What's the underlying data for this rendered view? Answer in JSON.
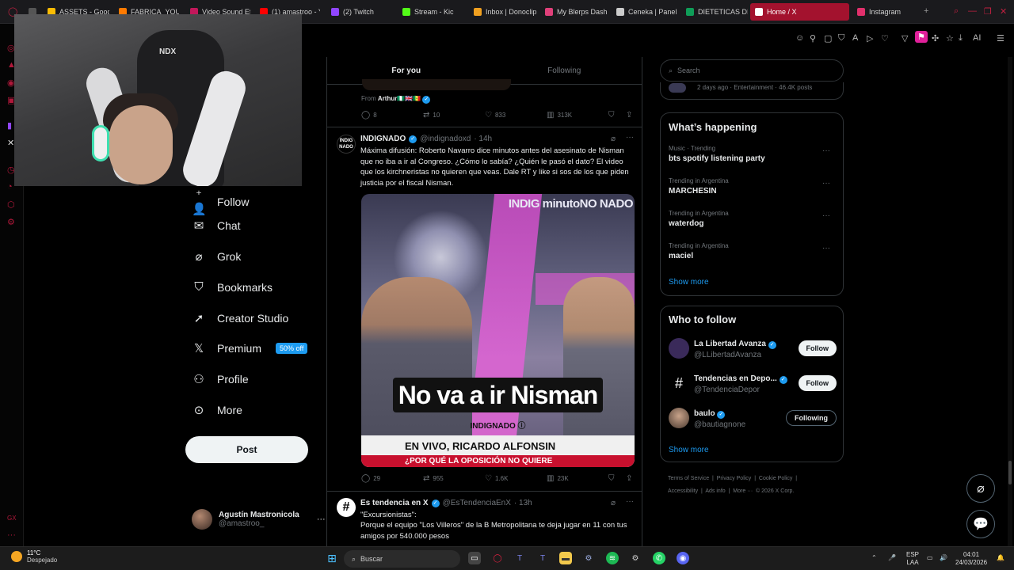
{
  "browser": {
    "tabs": [
      {
        "label": "",
        "color": "#555555"
      },
      {
        "label": "ASSETS - Goog",
        "color": "#fbbc04"
      },
      {
        "label": "FABRICA_YOUT",
        "color": "#ff7a00"
      },
      {
        "label": "Video Sound Ef",
        "color": "#c2185b"
      },
      {
        "label": "(1) amastroo - Y",
        "color": "#ff0000"
      },
      {
        "label": "(2) Twitch",
        "color": "#9146ff"
      },
      {
        "label": "Stream - Kic",
        "color": "#53fc18"
      },
      {
        "label": "Inbox | Donoclip",
        "color": "#f0a020"
      },
      {
        "label": "My Blerps Dash",
        "color": "#e0407a"
      },
      {
        "label": "Ceneka | Panel",
        "color": "#cccccc"
      },
      {
        "label": "DIETETICAS DI",
        "color": "#0f9d58"
      },
      {
        "label": "Home / X",
        "color": "#ffffff"
      },
      {
        "label": "Instagram",
        "color": "#e1306c"
      }
    ],
    "new_tab": "+",
    "toolbar_ai": "AI"
  },
  "sidebar": {
    "items": [
      {
        "label": "Follow",
        "icon": "+"
      },
      {
        "label": "Chat",
        "icon": "✉"
      },
      {
        "label": "Grok",
        "icon": "⌀"
      },
      {
        "label": "Bookmarks",
        "icon": "▯"
      },
      {
        "label": "Creator Studio",
        "icon": "🚀"
      },
      {
        "label": "Premium",
        "icon": "𝕏"
      },
      {
        "label": "Profile",
        "icon": "👤"
      },
      {
        "label": "More",
        "icon": "⋯"
      }
    ],
    "premium_badge": "50% off",
    "post_label": "Post",
    "account_name": "Agustín Mastronicola",
    "account_handle": "@amastroo_",
    "account_more": "···"
  },
  "timeline": {
    "tabs": [
      "For you",
      "Following"
    ],
    "prev_from_prefix": "From ",
    "prev_from_name": "Arthur🇳🇬🇬🇧🇸🇳",
    "prev_actions": {
      "replies": "8",
      "reposts": "10",
      "likes": "833",
      "views": "313K"
    },
    "tweet1": {
      "author": "INDIGNADO",
      "handle": "@indignadoxd",
      "time": "· 14h",
      "avatar_text": "INDIG NADO",
      "text": "Máxima difusión: Roberto Navarro dice minutos antes del asesinato de Nisman que no iba a ir al Congreso. ¿Cómo lo sabía? ¿Quién le pasó el dato? El video que los kirchneristas no quieren que veas. Dale RT y like si sos de los que piden justicia por el fiscal Nisman.",
      "video_watermark": "INDIG minutoNO NADO",
      "video_caption": "No va a ir Nisman",
      "video_subcaption": "INDIGNADO ⓘ",
      "video_lower": "EN VIVO, RICARDO ALFONSIN",
      "video_lower2": "¿POR QUÉ LA OPOSICIÓN NO QUIERE",
      "actions": {
        "replies": "29",
        "reposts": "955",
        "likes": "1.6K",
        "views": "23K"
      }
    },
    "tweet2": {
      "author": "Es tendencia en X",
      "handle": "@EsTendenciaEnX",
      "time": "· 13h",
      "avatar_text": "#",
      "line1": "\"Excursionistas\":",
      "line2": "Porque el equipo \"Los Villeros\" de la B Metropolitana te deja jugar en 11 con tus amigos por 540.000 pesos"
    }
  },
  "right": {
    "search_placeholder": "Search",
    "top_meta": "2 days ago · Entertainment · 46.4K posts",
    "whats_happening_title": "What’s happening",
    "trends": [
      {
        "meta": "Music · Trending",
        "topic": "bts spotify listening party"
      },
      {
        "meta": "Trending in Argentina",
        "topic": "MARCHESIN"
      },
      {
        "meta": "Trending in Argentina",
        "topic": "waterdog"
      },
      {
        "meta": "Trending in Argentina",
        "topic": "maciel"
      }
    ],
    "show_more": "Show more",
    "who_to_follow_title": "Who to follow",
    "who_to_follow": [
      {
        "name": "La Libertad Avanza",
        "handle": "@LLibertadAvanza",
        "button": "Follow"
      },
      {
        "name": "Tendencias en Depo...",
        "handle": "@TendenciaDepor",
        "button": "Follow"
      },
      {
        "name": "baulo",
        "handle": "@bautiagnone",
        "button": "Following"
      }
    ],
    "footer": [
      "Terms of Service",
      "|",
      "Privacy Policy",
      "|",
      "Cookie Policy",
      "|",
      "Accessibility",
      "|",
      "Ads info",
      "|",
      "More ···",
      "© 2026 X Corp."
    ]
  },
  "taskbar": {
    "temp": "11°C",
    "weather": "Despejado",
    "search": "Buscar",
    "lang1": "ESP",
    "lang2": "LAA",
    "time": "04:01",
    "date": "24/03/2026"
  }
}
